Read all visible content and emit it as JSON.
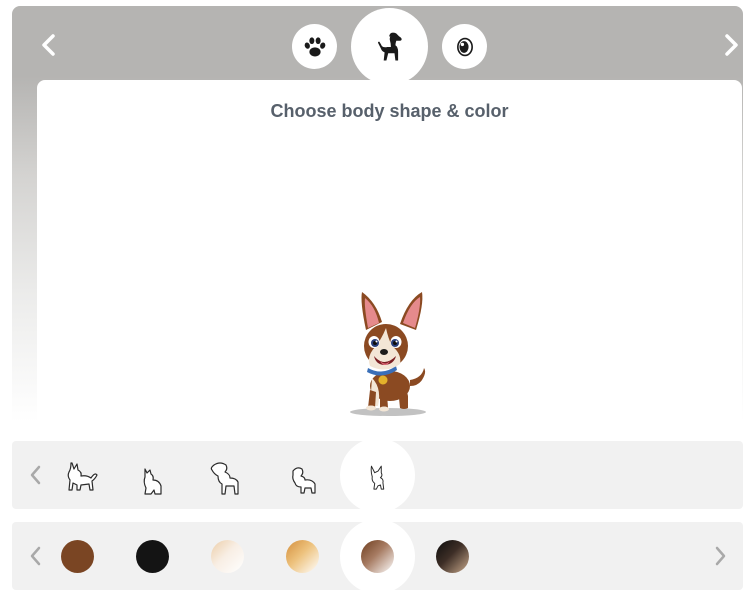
{
  "header": {
    "prev_icon": "chevron-left-icon",
    "next_icon": "chevron-right-icon",
    "steps": [
      {
        "icon": "paw-icon",
        "active": false
      },
      {
        "icon": "dog-icon",
        "active": true
      },
      {
        "icon": "eye-icon",
        "active": false
      }
    ]
  },
  "canvas": {
    "title": "Choose body shape & color",
    "preview_icon": "dog-character-image"
  },
  "shape_row": {
    "selected_index": 4,
    "shapes": [
      "shepherd-dog-icon",
      "sitting-dog-icon",
      "poodle-dog-icon",
      "pug-dog-icon",
      "chihuahua-dog-icon"
    ]
  },
  "color_row": {
    "selected_index": 4,
    "swatches": [
      {
        "name": "brown",
        "color": "#7a4523"
      },
      {
        "name": "black",
        "color": "#141414"
      },
      {
        "name": "cream",
        "color": "#f3ddc3"
      },
      {
        "name": "tan",
        "color": "#e2a85d"
      },
      {
        "name": "brown-white",
        "color": "#8a5a3e"
      },
      {
        "name": "black-tan",
        "color": "#2a2220"
      }
    ]
  },
  "colors": {
    "header_bg": "#b5b4b2",
    "title_text": "#57606b",
    "row_bg": "#f1f1f1",
    "arrow_gray": "#a9a9a9"
  }
}
